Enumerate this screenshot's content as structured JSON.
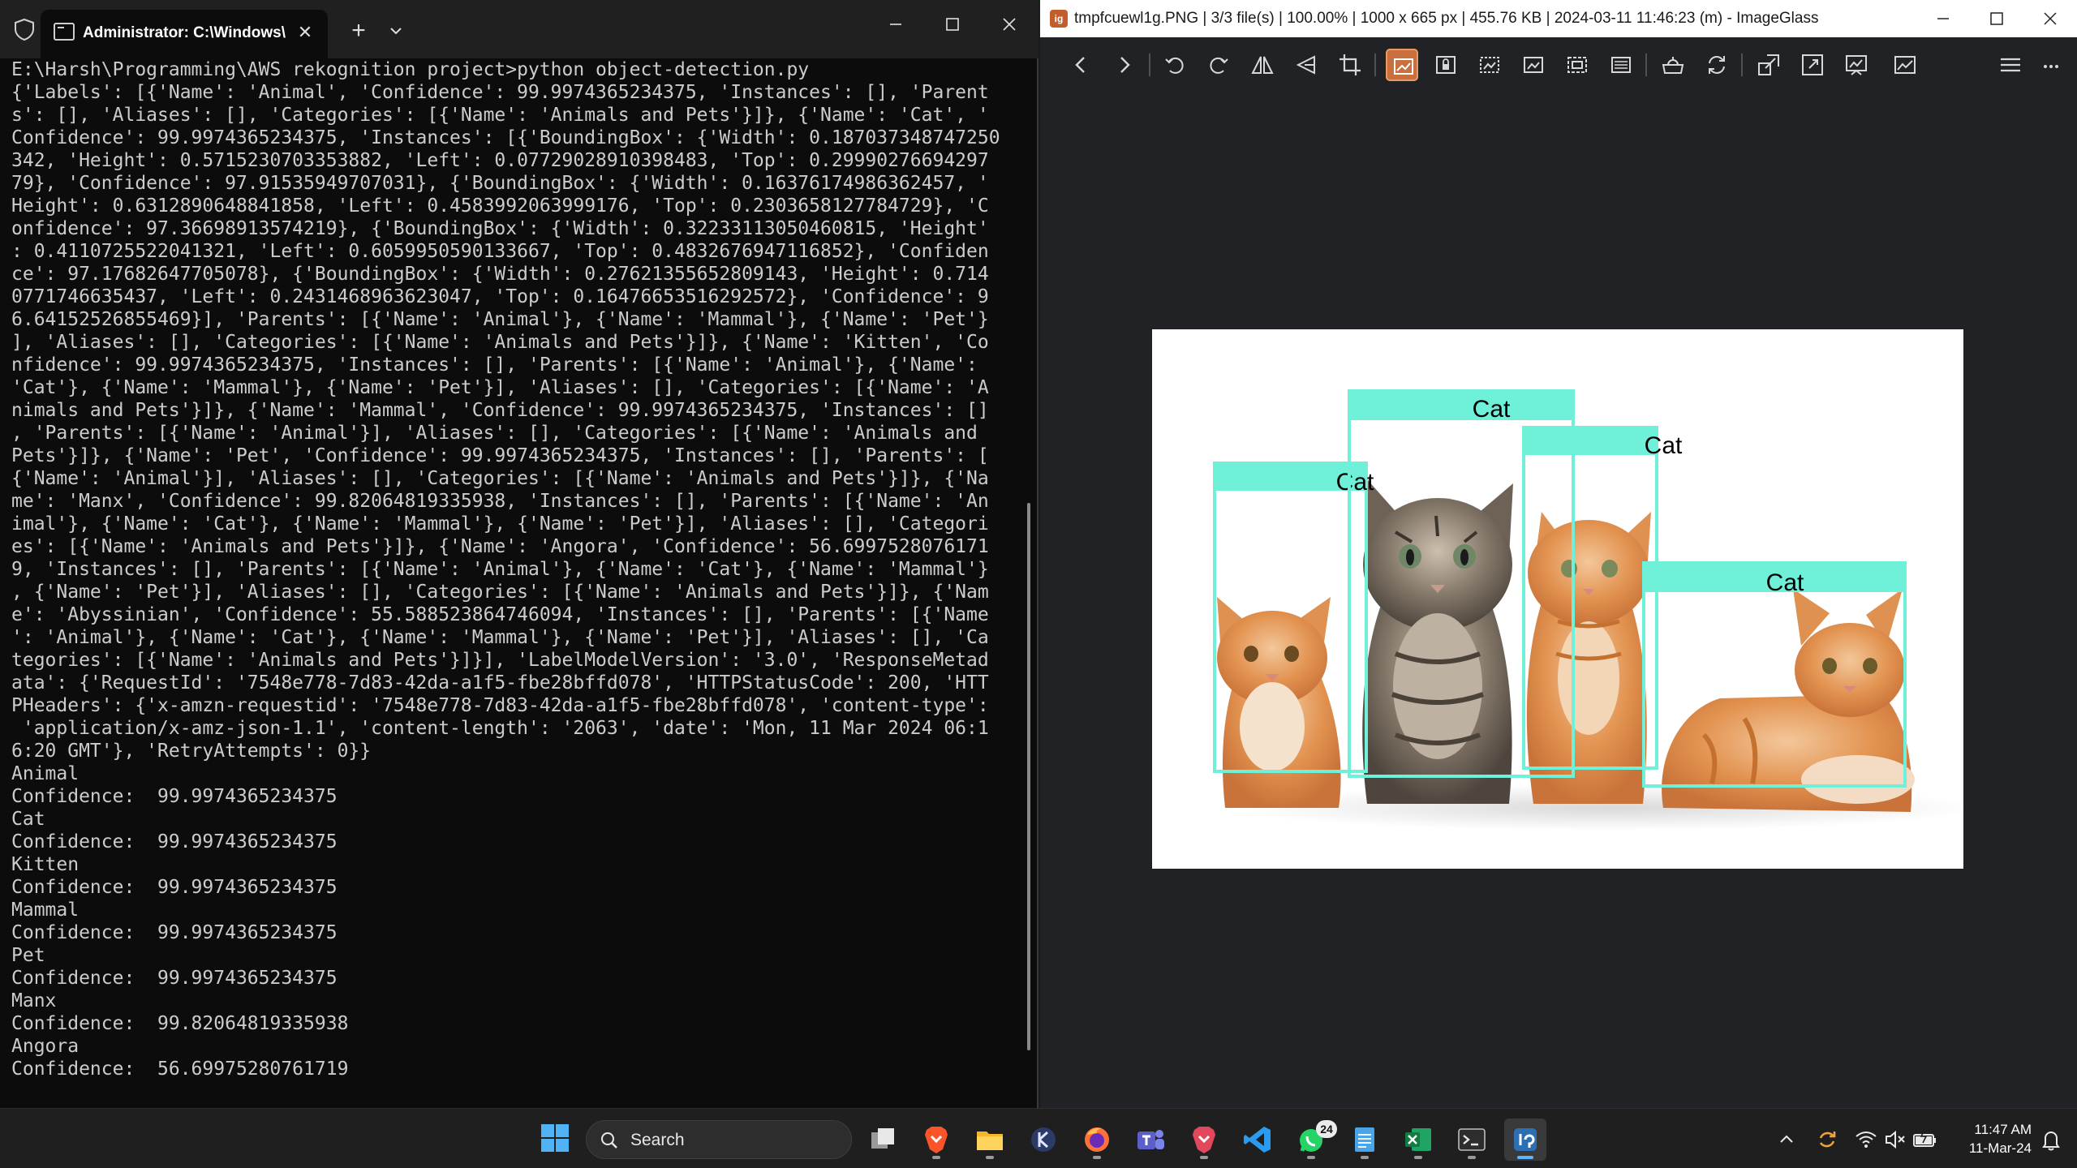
{
  "terminal": {
    "tab_title": "Administrator: C:\\Windows\\Sy",
    "lines": [
      "E:\\Harsh\\Programming\\AWS rekognition project>python object-detection.py",
      "{'Labels': [{'Name': 'Animal', 'Confidence': 99.9974365234375, 'Instances': [], 'Parent",
      "s': [], 'Aliases': [], 'Categories': [{'Name': 'Animals and Pets'}]}, {'Name': 'Cat', '",
      "Confidence': 99.9974365234375, 'Instances': [{'BoundingBox': {'Width': 0.187037348747250",
      "342, 'Height': 0.5715230703353882, 'Left': 0.07729028910398483, 'Top': 0.29990276694297",
      "79}, 'Confidence': 97.91535949707031}, {'BoundingBox': {'Width': 0.16376174986362457, '",
      "Height': 0.6312890648841858, 'Left': 0.4583992063999176, 'Top': 0.2303658127784729}, 'C",
      "onfidence': 97.36698913574219}, {'BoundingBox': {'Width': 0.32233113050460815, 'Height'",
      ": 0.4110725522041321, 'Left': 0.6059950590133667, 'Top': 0.4832676947116852}, 'Confiden",
      "ce': 97.17682647705078}, {'BoundingBox': {'Width': 0.27621355652809143, 'Height': 0.714",
      "0771746635437, 'Left': 0.2431468963623047, 'Top': 0.16476653516292572}, 'Confidence': 9",
      "6.64152526855469}], 'Parents': [{'Name': 'Animal'}, {'Name': 'Mammal'}, {'Name': 'Pet'}",
      "], 'Aliases': [], 'Categories': [{'Name': 'Animals and Pets'}]}, {'Name': 'Kitten', 'Co",
      "nfidence': 99.9974365234375, 'Instances': [], 'Parents': [{'Name': 'Animal'}, {'Name':",
      "'Cat'}, {'Name': 'Mammal'}, {'Name': 'Pet'}], 'Aliases': [], 'Categories': [{'Name': 'A",
      "nimals and Pets'}]}, {'Name': 'Mammal', 'Confidence': 99.9974365234375, 'Instances': []",
      ", 'Parents': [{'Name': 'Animal'}], 'Aliases': [], 'Categories': [{'Name': 'Animals and",
      "Pets'}]}, {'Name': 'Pet', 'Confidence': 99.9974365234375, 'Instances': [], 'Parents': [",
      "{'Name': 'Animal'}], 'Aliases': [], 'Categories': [{'Name': 'Animals and Pets'}]}, {'Na",
      "me': 'Manx', 'Confidence': 99.82064819335938, 'Instances': [], 'Parents': [{'Name': 'An",
      "imal'}, {'Name': 'Cat'}, {'Name': 'Mammal'}, {'Name': 'Pet'}], 'Aliases': [], 'Categori",
      "es': [{'Name': 'Animals and Pets'}]}, {'Name': 'Angora', 'Confidence': 56.6997528076171",
      "9, 'Instances': [], 'Parents': [{'Name': 'Animal'}, {'Name': 'Cat'}, {'Name': 'Mammal'}",
      ", {'Name': 'Pet'}], 'Aliases': [], 'Categories': [{'Name': 'Animals and Pets'}]}, {'Nam",
      "e': 'Abyssinian', 'Confidence': 55.588523864746094, 'Instances': [], 'Parents': [{'Name",
      "': 'Animal'}, {'Name': 'Cat'}, {'Name': 'Mammal'}, {'Name': 'Pet'}], 'Aliases': [], 'Ca",
      "tegories': [{'Name': 'Animals and Pets'}]}], 'LabelModelVersion': '3.0', 'ResponseMetad",
      "ata': {'RequestId': '7548e778-7d83-42da-a1f5-fbe28bffd078', 'HTTPStatusCode': 200, 'HTT",
      "PHeaders': {'x-amzn-requestid': '7548e778-7d83-42da-a1f5-fbe28bffd078', 'content-type':",
      " 'application/x-amz-json-1.1', 'content-length': '2063', 'date': 'Mon, 11 Mar 2024 06:1",
      "6:20 GMT'}, 'RetryAttempts': 0}}",
      "Animal",
      "Confidence:  99.9974365234375",
      "Cat",
      "Confidence:  99.9974365234375",
      "Kitten",
      "Confidence:  99.9974365234375",
      "Mammal",
      "Confidence:  99.9974365234375",
      "Pet",
      "Confidence:  99.9974365234375",
      "Manx",
      "Confidence:  99.82064819335938",
      "Angora",
      "Confidence:  56.69975280761719"
    ]
  },
  "imageglass": {
    "title": "tmpfcuewl1g.PNG  |  3/3 file(s)  |  100.00%  |  1000 x 665 px  |  455.76 KB  |  2024-03-11 11:46:23 (m)  - ImageGlass",
    "logo_text": "ig",
    "detections": [
      {
        "label": "Cat"
      },
      {
        "label": "Cat"
      },
      {
        "label": "Cat"
      },
      {
        "label": "Cat"
      }
    ],
    "box_color": "#6ff0d8"
  },
  "taskbar": {
    "search_label": "Search",
    "whatsapp_badge": "24",
    "time": "11:47 AM",
    "date": "11-Mar-24",
    "accent_color": "#5fb2ff"
  }
}
